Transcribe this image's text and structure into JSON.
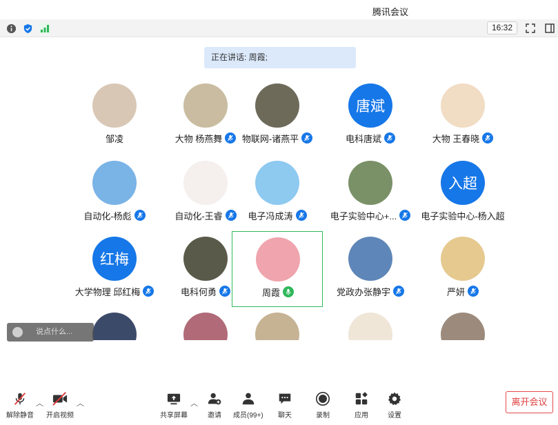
{
  "window": {
    "title": "腾讯会议"
  },
  "top_toolbar": {
    "time": "16:32"
  },
  "speaker_banner": "正在讲话: 周霞;",
  "participants": [
    {
      "name": "邹凌",
      "mic": false,
      "avatar_text": "",
      "avatar_bg": "#d9c7b5"
    },
    {
      "name": "大物 杨燕舞",
      "mic": true,
      "avatar_text": "",
      "avatar_bg": "#c9bca0"
    },
    {
      "name": "物联网-诸燕平",
      "mic": true,
      "avatar_text": "",
      "avatar_bg": "#6e6a5a"
    },
    {
      "name": "电科唐斌",
      "mic": true,
      "avatar_text": "唐斌",
      "avatar_bg": "#1677e8"
    },
    {
      "name": "大物 王春晓",
      "mic": true,
      "avatar_text": "",
      "avatar_bg": "#f1dcc4"
    },
    {
      "name": "自动化-杨彪",
      "mic": true,
      "avatar_text": "",
      "avatar_bg": "#7ab3e6"
    },
    {
      "name": "自动化-王睿",
      "mic": true,
      "avatar_text": "",
      "avatar_bg": "#f5efee"
    },
    {
      "name": "电子冯成涛",
      "mic": true,
      "avatar_text": "",
      "avatar_bg": "#8ec9f0"
    },
    {
      "name": "电子实验中心+...",
      "mic": true,
      "avatar_text": "",
      "avatar_bg": "#7a9168"
    },
    {
      "name": "电子实验中心-杨入超",
      "mic": false,
      "avatar_text": "入超",
      "avatar_bg": "#1677e8"
    },
    {
      "name": "大学物理 邱红梅",
      "mic": true,
      "avatar_text": "红梅",
      "avatar_bg": "#1677e8"
    },
    {
      "name": "电科何勇",
      "mic": true,
      "avatar_text": "",
      "avatar_bg": "#5a5a4a"
    },
    {
      "name": "周霞",
      "mic": true,
      "speaking": true,
      "avatar_text": "",
      "avatar_bg": "#f0a4ad"
    },
    {
      "name": "党政办张静宇",
      "mic": true,
      "avatar_text": "",
      "avatar_bg": "#5f86b8"
    },
    {
      "name": "严妍",
      "mic": true,
      "avatar_text": "",
      "avatar_bg": "#e5c98f"
    },
    {
      "name": "",
      "mic": false,
      "avatar_text": "",
      "avatar_bg": "#3c4a6a"
    },
    {
      "name": "",
      "mic": false,
      "avatar_text": "",
      "avatar_bg": "#b06a78"
    },
    {
      "name": "",
      "mic": false,
      "avatar_text": "",
      "avatar_bg": "#c6b394"
    },
    {
      "name": "",
      "mic": false,
      "avatar_text": "",
      "avatar_bg": "#efe6d8"
    },
    {
      "name": "",
      "mic": false,
      "avatar_text": "",
      "avatar_bg": "#9c8b7c"
    }
  ],
  "chat_input": {
    "placeholder": "说点什么..."
  },
  "bottom_bar": {
    "unmute": "解除静音",
    "start_video": "开启视频",
    "share_screen": "共享屏幕",
    "invite": "邀请",
    "members": "成员(99+)",
    "chat": "聊天",
    "record": "录制",
    "apps": "应用",
    "settings": "设置",
    "leave": "离开会议"
  },
  "colors": {
    "accent": "#1677e8",
    "speaking": "#2fb85a",
    "danger": "#e34b4b",
    "muted": "#e33a3a"
  }
}
